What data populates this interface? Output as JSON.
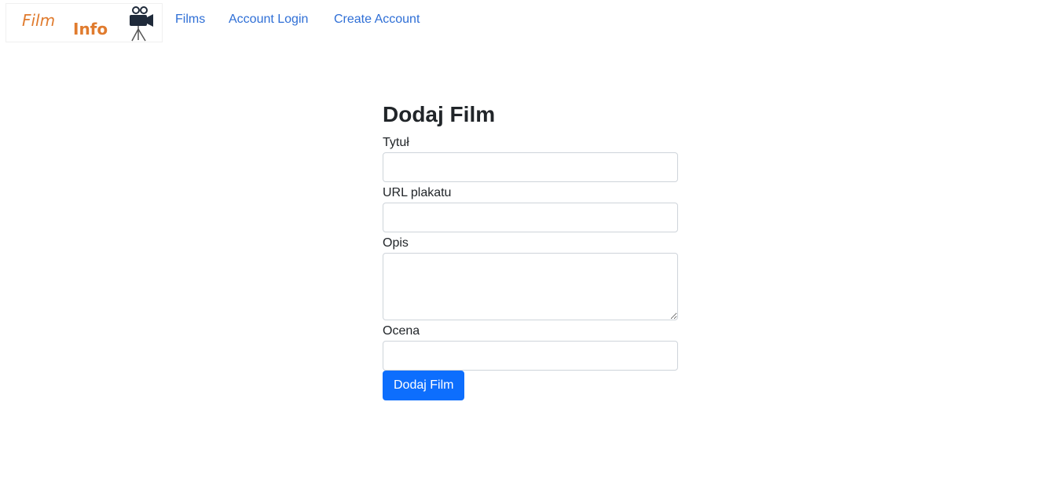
{
  "brand": {
    "logo_text_1": "Film",
    "logo_text_2": "Info",
    "logo_icon": "movie-camera-icon",
    "logo_color": "#e07b2e"
  },
  "nav": {
    "items": [
      {
        "label": "Films"
      },
      {
        "label": "Account Login"
      },
      {
        "label": "Create Account"
      }
    ],
    "link_color": "#2f6fd6"
  },
  "form": {
    "title": "Dodaj Film",
    "fields": {
      "title": {
        "label": "Tytuł",
        "value": ""
      },
      "poster_url": {
        "label": "URL plakatu",
        "value": ""
      },
      "description": {
        "label": "Opis",
        "value": ""
      },
      "rating": {
        "label": "Ocena",
        "value": ""
      }
    },
    "submit_label": "Dodaj Film",
    "button_color": "#0d6efd"
  }
}
